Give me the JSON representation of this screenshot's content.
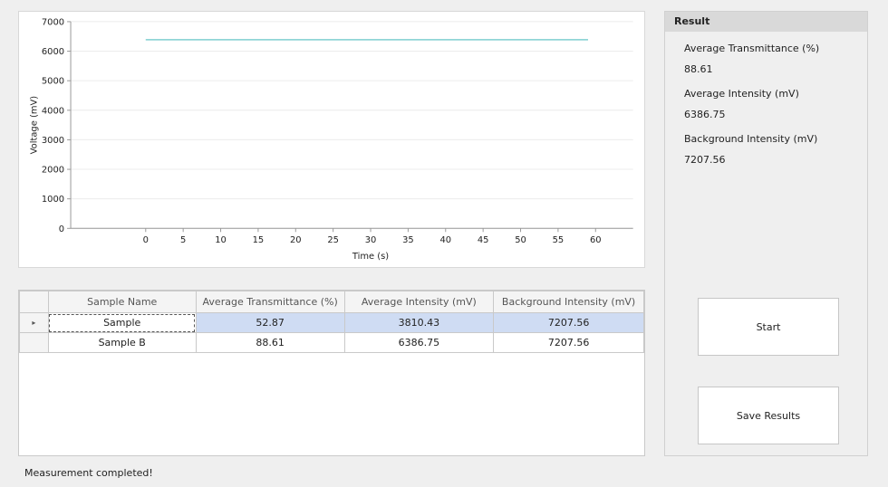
{
  "chart_data": {
    "type": "line",
    "xlabel": "Time (s)",
    "ylabel": "Voltage (mV)",
    "xlim": [
      -10,
      65
    ],
    "ylim": [
      0,
      7000
    ],
    "xticks": [
      0,
      5,
      10,
      15,
      20,
      25,
      30,
      35,
      40,
      45,
      50,
      55,
      60
    ],
    "yticks": [
      0,
      1000,
      2000,
      3000,
      4000,
      5000,
      6000,
      7000
    ],
    "series": [
      {
        "color": "#7fcfd1",
        "x": [
          0,
          59
        ],
        "y": [
          6386.75,
          6386.75
        ]
      }
    ],
    "grid": true
  },
  "table": {
    "columns": [
      "Sample Name",
      "Average Transmittance (%)",
      "Average Intensity (mV)",
      "Background Intensity (mV)"
    ],
    "rows": [
      [
        "Sample",
        "52.87",
        "3810.43",
        "7207.56"
      ],
      [
        "Sample B",
        "88.61",
        "6386.75",
        "7207.56"
      ]
    ],
    "selected_row_marker": "▸"
  },
  "result": {
    "title": "Result",
    "transmittance_label": "Average Transmittance (%)",
    "transmittance_value": "88.61",
    "intensity_label": "Average Intensity (mV)",
    "intensity_value": "6386.75",
    "background_label": "Background Intensity (mV)",
    "background_value": "7207.56"
  },
  "buttons": {
    "start": "Start",
    "save": "Save Results"
  },
  "status": "Measurement completed!"
}
